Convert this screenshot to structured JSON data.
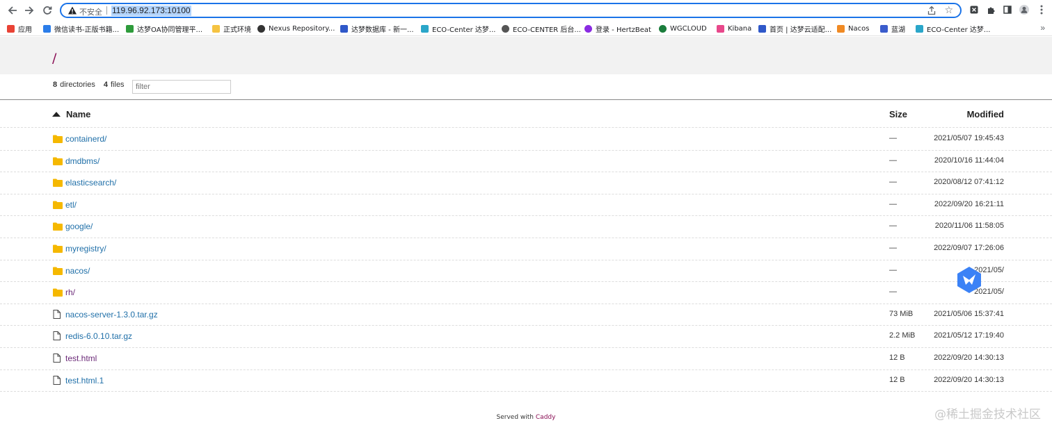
{
  "browser": {
    "insecure_label": "不安全",
    "url": "119.96.92.173:10100",
    "bookmarks": [
      {
        "label": "应用",
        "icon": "apps-grid-icon",
        "color": "#e94235"
      },
      {
        "label": "微信读书-正版书籍...",
        "icon": "weread-icon",
        "color": "#2b7de9"
      },
      {
        "label": "达梦OA协同管理平...",
        "icon": "oa-icon",
        "color": "#2e9b3b"
      },
      {
        "label": "正式环境",
        "icon": "folder-icon",
        "color": "#f5c342"
      },
      {
        "label": "Nexus Repository...",
        "icon": "nexus-icon",
        "color": "#333333"
      },
      {
        "label": "达梦数据库 - 新一...",
        "icon": "dameng-icon",
        "color": "#2f58c9"
      },
      {
        "label": "ECO-Center 达梦...",
        "icon": "eco-icon",
        "color": "#2aa6c9"
      },
      {
        "label": "ECO-CENTER 后台...",
        "icon": "globe-icon",
        "color": "#555555"
      },
      {
        "label": "登录 - HertzBeat",
        "icon": "hertzbeat-icon",
        "color": "#8a2be2"
      },
      {
        "label": "WGCLOUD",
        "icon": "wgcloud-icon",
        "color": "#1b7d3c"
      },
      {
        "label": "Kibana",
        "icon": "kibana-icon",
        "color": "#e8488b"
      },
      {
        "label": "首页 | 达梦云适配...",
        "icon": "dameng-icon",
        "color": "#2f58c9"
      },
      {
        "label": "Nacos",
        "icon": "nacos-icon",
        "color": "#f08a24"
      },
      {
        "label": "蓝湖",
        "icon": "lanhu-icon",
        "color": "#3a5ccc"
      },
      {
        "label": "ECO-Center 达梦...",
        "icon": "eco-icon",
        "color": "#2aa6c9"
      }
    ],
    "more_label": "»"
  },
  "listing": {
    "path": "/",
    "dir_count": "8",
    "dir_label": "directories",
    "file_count": "4",
    "file_label": "files",
    "filter_placeholder": "filter",
    "columns": {
      "name": "Name",
      "size": "Size",
      "modified": "Modified"
    },
    "rows": [
      {
        "type": "dir",
        "name": "containerd/",
        "size": "—",
        "modified": "2021/05/07 19:45:43",
        "visited": false
      },
      {
        "type": "dir",
        "name": "dmdbms/",
        "size": "—",
        "modified": "2020/10/16 11:44:04",
        "visited": false
      },
      {
        "type": "dir",
        "name": "elasticsearch/",
        "size": "—",
        "modified": "2020/08/12 07:41:12",
        "visited": false
      },
      {
        "type": "dir",
        "name": "etl/",
        "size": "—",
        "modified": "2022/09/20 16:21:11",
        "visited": false
      },
      {
        "type": "dir",
        "name": "google/",
        "size": "—",
        "modified": "2020/11/06 11:58:05",
        "visited": false
      },
      {
        "type": "dir",
        "name": "myregistry/",
        "size": "—",
        "modified": "2022/09/07 17:26:06",
        "visited": false
      },
      {
        "type": "dir",
        "name": "nacos/",
        "size": "—",
        "modified": "2021/05/",
        "visited": false
      },
      {
        "type": "dir",
        "name": "rh/",
        "size": "—",
        "modified": "2021/05/",
        "visited": true
      },
      {
        "type": "file",
        "name": "nacos-server-1.3.0.tar.gz",
        "size": "73 MiB",
        "modified": "2021/05/06 15:37:41",
        "visited": false
      },
      {
        "type": "file",
        "name": "redis-6.0.10.tar.gz",
        "size": "2.2 MiB",
        "modified": "2021/05/12 17:19:40",
        "visited": false
      },
      {
        "type": "file",
        "name": "test.html",
        "size": "12 B",
        "modified": "2022/09/20 14:30:13",
        "visited": true
      },
      {
        "type": "file",
        "name": "test.html.1",
        "size": "12 B",
        "modified": "2022/09/20 14:30:13",
        "visited": false
      }
    ]
  },
  "footer": {
    "served_with": "Served with",
    "server": "Caddy"
  },
  "watermark": "@稀土掘金技术社区",
  "colors": {
    "accent": "#1a73e8",
    "path": "#8a0f55",
    "link": "#1f6fa8",
    "visited": "#6b2a78",
    "folder": "#f5b800"
  }
}
